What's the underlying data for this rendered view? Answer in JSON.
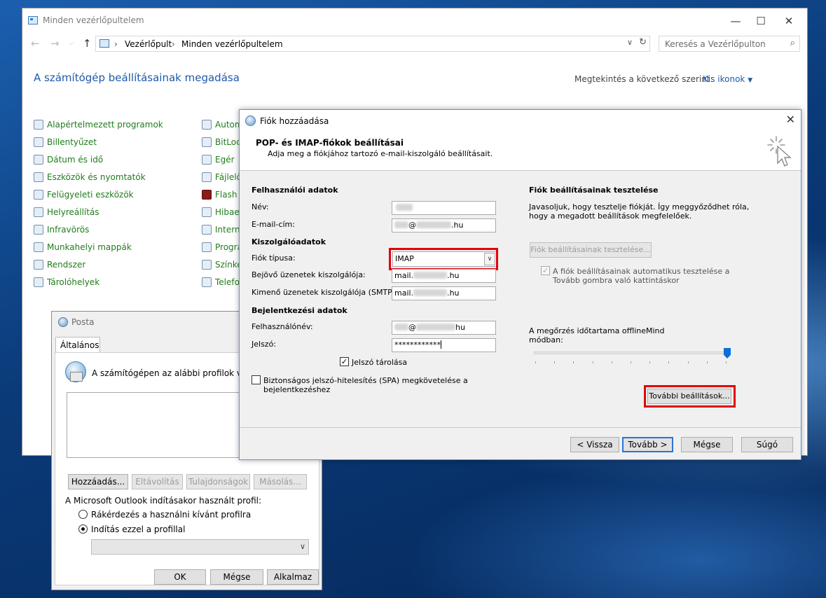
{
  "control_panel": {
    "window_title": "Minden vezérlőpultelem",
    "breadcrumb": [
      "Vezérlőpult",
      "Minden vezérlőpultelem"
    ],
    "search_placeholder": "Keresés a Vezérlőpulton",
    "heading": "A számítógép beállításainak megadása",
    "view_by_label": "Megtekintés a következő szerint:",
    "view_by_value": "Kis ikonok",
    "items_col1": [
      "Alapértelmezett programok",
      "Billentyűzet",
      "Dátum és idő",
      "Eszközök és nyomtatók",
      "Felügyeleti eszközök",
      "Helyreállítás",
      "Infravörös",
      "Munkahelyi mappák",
      "Rendszer",
      "Tárolóhelyek"
    ],
    "items_col2": [
      "Autom",
      "BitLoc",
      "Egér",
      "Fájlelő",
      "Flash P",
      "Hibaelh",
      "Interne",
      "Progra",
      "Színke",
      "Telefo"
    ]
  },
  "posta": {
    "title": "Posta",
    "tab_label": "Általános",
    "intro": "A számítógépen az alábbi profilok vannak",
    "buttons": {
      "add": "Hozzáadás...",
      "remove": "Eltávolítás",
      "properties": "Tulajdonságok",
      "copy": "Másolás..."
    },
    "startup_label": "A Microsoft Outlook indításakor használt profil:",
    "radio_prompt": "Rákérdezés a használni kívánt profilra",
    "radio_always": "Indítás ezzel a profillal",
    "ok": "OK",
    "cancel": "Mégse",
    "apply": "Alkalmaz"
  },
  "account_dialog": {
    "title": "Fiók hozzáadása",
    "header_title": "POP- és IMAP-fiókok beállításai",
    "header_subtitle": "Adja meg a fiókjához tartozó e-mail-kiszolgáló beállításait.",
    "user_section": "Felhasználói adatok",
    "name_label": "Név:",
    "email_label": "E-mail-cím:",
    "email_at": "@",
    "email_suffix": ".hu",
    "server_section": "Kiszolgálóadatok",
    "account_type_label": "Fiók típusa:",
    "account_type_value": "IMAP",
    "incoming_label": "Bejövő üzenetek kiszolgálója:",
    "incoming_prefix": "mail.",
    "incoming_suffix": ".hu",
    "outgoing_label": "Kimenő üzenetek kiszolgálója (SMTP):",
    "outgoing_prefix": "mail.",
    "outgoing_suffix": ".hu",
    "login_section": "Bejelentkezési adatok",
    "username_label": "Felhasználónév:",
    "username_at": "@",
    "username_suffix": "hu",
    "password_label": "Jelszó:",
    "password_value": "************",
    "remember_password": "Jelszó tárolása",
    "spa_label_line1": "Biztonságos jelszó-hitelesítés (SPA) megkövetelése a",
    "spa_label_line2": "bejelentkezéshez",
    "test_section": "Fiók beállításainak tesztelése",
    "test_desc_line1": "Javasoljuk, hogy tesztelje fiókját. Így meggyőződhet róla,",
    "test_desc_line2": "hogy a megadott beállítások megfelelőek.",
    "test_button": "Fiók beállításainak tesztelése...",
    "auto_test_line1": "A fiók beállításainak automatikus tesztelése a",
    "auto_test_line2": "Tovább gombra való kattintáskor",
    "offline_label_line1": "A megőrzés időtartama offline",
    "offline_label_line2": "módban:",
    "offline_value": "Mind",
    "offline_slider_fraction": 1.0,
    "more_settings": "További beállítások...",
    "back": "< Vissza",
    "next": "Tovább >",
    "cancel": "Mégse",
    "help": "Súgó"
  }
}
